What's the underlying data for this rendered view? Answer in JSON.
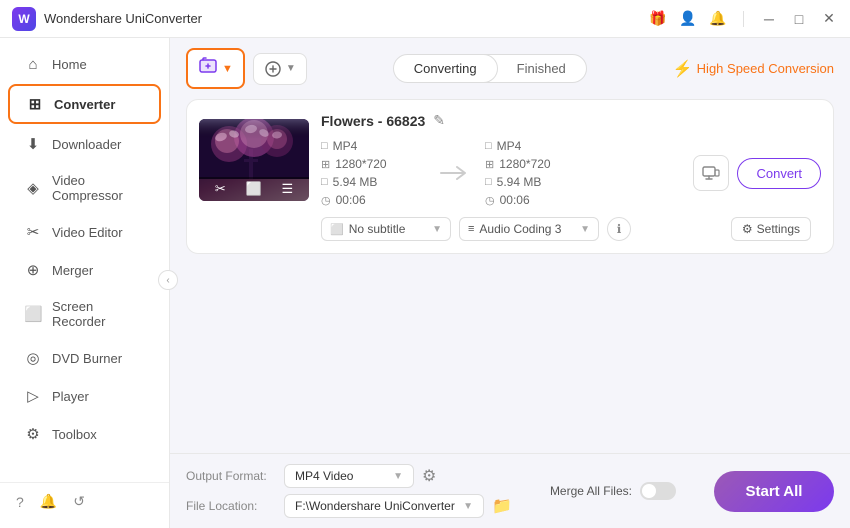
{
  "app": {
    "title": "Wondershare UniConverter",
    "logo_text": "W"
  },
  "titlebar": {
    "icons": {
      "gift": "🎁",
      "user": "👤",
      "bell": "🔔",
      "minimize": "─",
      "maximize": "□",
      "close": "✕"
    }
  },
  "sidebar": {
    "items": [
      {
        "id": "home",
        "label": "Home",
        "icon": "⌂"
      },
      {
        "id": "converter",
        "label": "Converter",
        "icon": "⊞",
        "active": true
      },
      {
        "id": "downloader",
        "label": "Downloader",
        "icon": "⬇"
      },
      {
        "id": "video-compressor",
        "label": "Video Compressor",
        "icon": "◈"
      },
      {
        "id": "video-editor",
        "label": "Video Editor",
        "icon": "✂"
      },
      {
        "id": "merger",
        "label": "Merger",
        "icon": "⊕"
      },
      {
        "id": "screen-recorder",
        "label": "Screen Recorder",
        "icon": "⬜"
      },
      {
        "id": "dvd-burner",
        "label": "DVD Burner",
        "icon": "◎"
      },
      {
        "id": "player",
        "label": "Player",
        "icon": "▷"
      },
      {
        "id": "toolbox",
        "label": "Toolbox",
        "icon": "⚙"
      }
    ],
    "footer_icons": [
      "?",
      "🔔",
      "↺"
    ]
  },
  "toolbar": {
    "add_button_label": "+",
    "add_device_label": "+",
    "tabs": {
      "converting": "Converting",
      "finished": "Finished"
    },
    "active_tab": "Converting",
    "high_speed_label": "High Speed Conversion"
  },
  "file_card": {
    "name": "Flowers - 66823",
    "edit_icon": "✎",
    "source": {
      "format": "MP4",
      "resolution": "1280*720",
      "size": "5.94 MB",
      "duration": "00:06"
    },
    "output": {
      "format": "MP4",
      "resolution": "1280*720",
      "size": "5.94 MB",
      "duration": "00:06"
    },
    "subtitle_label": "No subtitle",
    "audio_label": "Audio Coding 3",
    "settings_label": "Settings",
    "convert_label": "Convert"
  },
  "bottom_bar": {
    "output_format_label": "Output Format:",
    "output_format_value": "MP4 Video",
    "file_location_label": "File Location:",
    "file_location_value": "F:\\Wondershare UniConverter",
    "merge_label": "Merge All Files:",
    "start_all_label": "Start All"
  }
}
